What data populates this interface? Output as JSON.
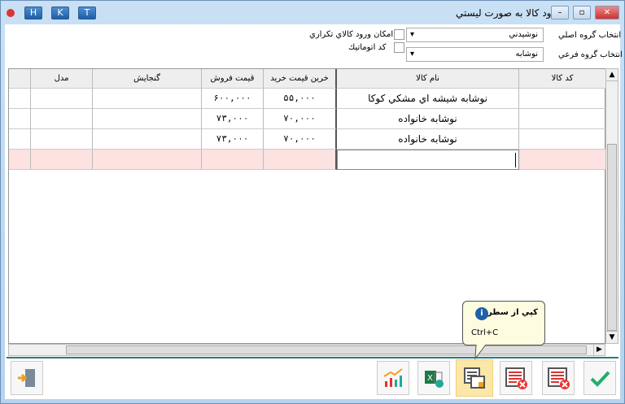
{
  "window": {
    "title": "ورود کالا به صورت ليستي",
    "buttons": [
      "H",
      "K",
      "T"
    ]
  },
  "filters": {
    "main_group_label": "انتخاب گروه اصلي",
    "main_group_value": "نوشيدني",
    "sub_group_label": "انتخاب گروه فرعي",
    "sub_group_value": "نوشابه",
    "allow_duplicate_label": "امكان ورود كالاي تكراري",
    "auto_code_label": "كد اتوماتيك"
  },
  "grid": {
    "columns": [
      "كد كالا",
      "نام كالا",
      "خرين قيمت خريد",
      "قيمت فروش",
      "گنجايش",
      "مدل"
    ],
    "rows": [
      {
        "code": "",
        "name": "نوشابه شيشه اي مشكي كوكا",
        "buy": "۵۵,۰۰۰",
        "sell": "۶۰۰,۰۰۰",
        "capacity": "",
        "model": ""
      },
      {
        "code": "",
        "name": "نوشابه خانواده",
        "buy": "۷۰,۰۰۰",
        "sell": "۷۳,۰۰۰",
        "capacity": "",
        "model": ""
      },
      {
        "code": "",
        "name": "نوشابه خانواده",
        "buy": "۷۰,۰۰۰",
        "sell": "۷۳,۰۰۰",
        "capacity": "",
        "model": ""
      }
    ]
  },
  "tooltip": {
    "title": "كپي از سطر",
    "shortcut": "Ctrl+C"
  },
  "colors": {
    "accent": "#2a7a7a",
    "new_row": "#fde2e2",
    "highlight": "#fbe7a8"
  }
}
